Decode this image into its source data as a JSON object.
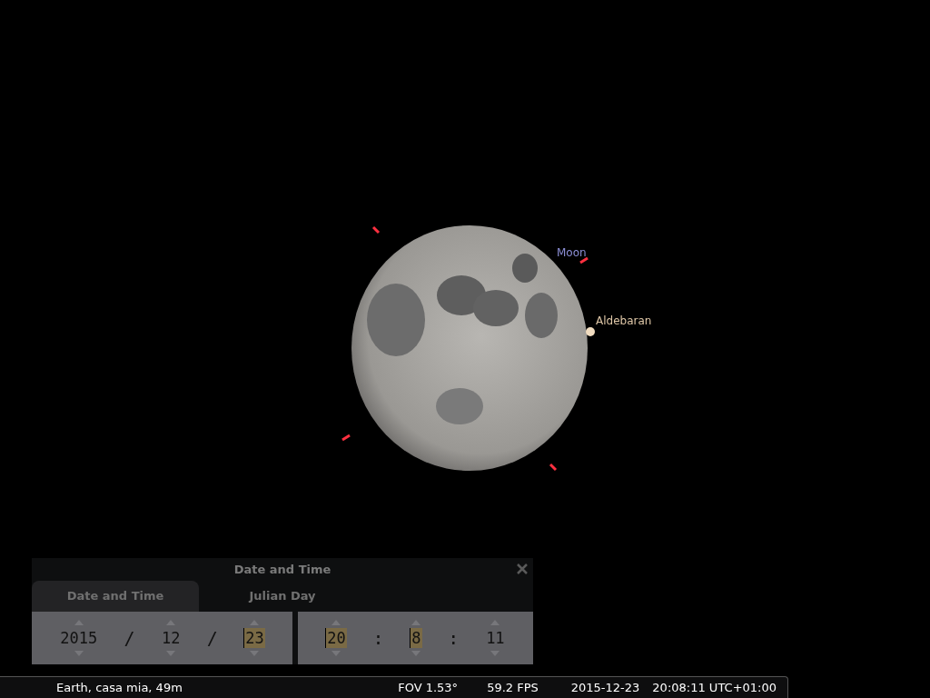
{
  "sky": {
    "labels": [
      {
        "text": "Moon",
        "kind": "planet"
      },
      {
        "text": "Aldebaran",
        "kind": "star"
      }
    ]
  },
  "dialog": {
    "title": "Date and Time",
    "tabs": [
      {
        "label": "Date and Time",
        "selected": true
      },
      {
        "label": "Julian Day",
        "selected": false
      }
    ],
    "date": [
      {
        "kind": "field",
        "value": "2015",
        "highlighted": false
      },
      {
        "kind": "separator",
        "value": "/"
      },
      {
        "kind": "field",
        "value": "12",
        "highlighted": false
      },
      {
        "kind": "separator",
        "value": "/"
      },
      {
        "kind": "field",
        "value": "23",
        "highlighted": true
      }
    ],
    "time": [
      {
        "kind": "field",
        "value": "20",
        "highlighted": true
      },
      {
        "kind": "separator",
        "value": ":"
      },
      {
        "kind": "field",
        "value": "8",
        "highlighted": true
      },
      {
        "kind": "separator",
        "value": ":"
      },
      {
        "kind": "field",
        "value": "11",
        "highlighted": false
      }
    ]
  },
  "status_bar": {
    "location": "Earth, casa mia, 49m",
    "fov": "FOV 1.53°",
    "fps": "59.2 FPS",
    "date": "2015-12-23",
    "time": "20:08:11 UTC+01:00"
  }
}
